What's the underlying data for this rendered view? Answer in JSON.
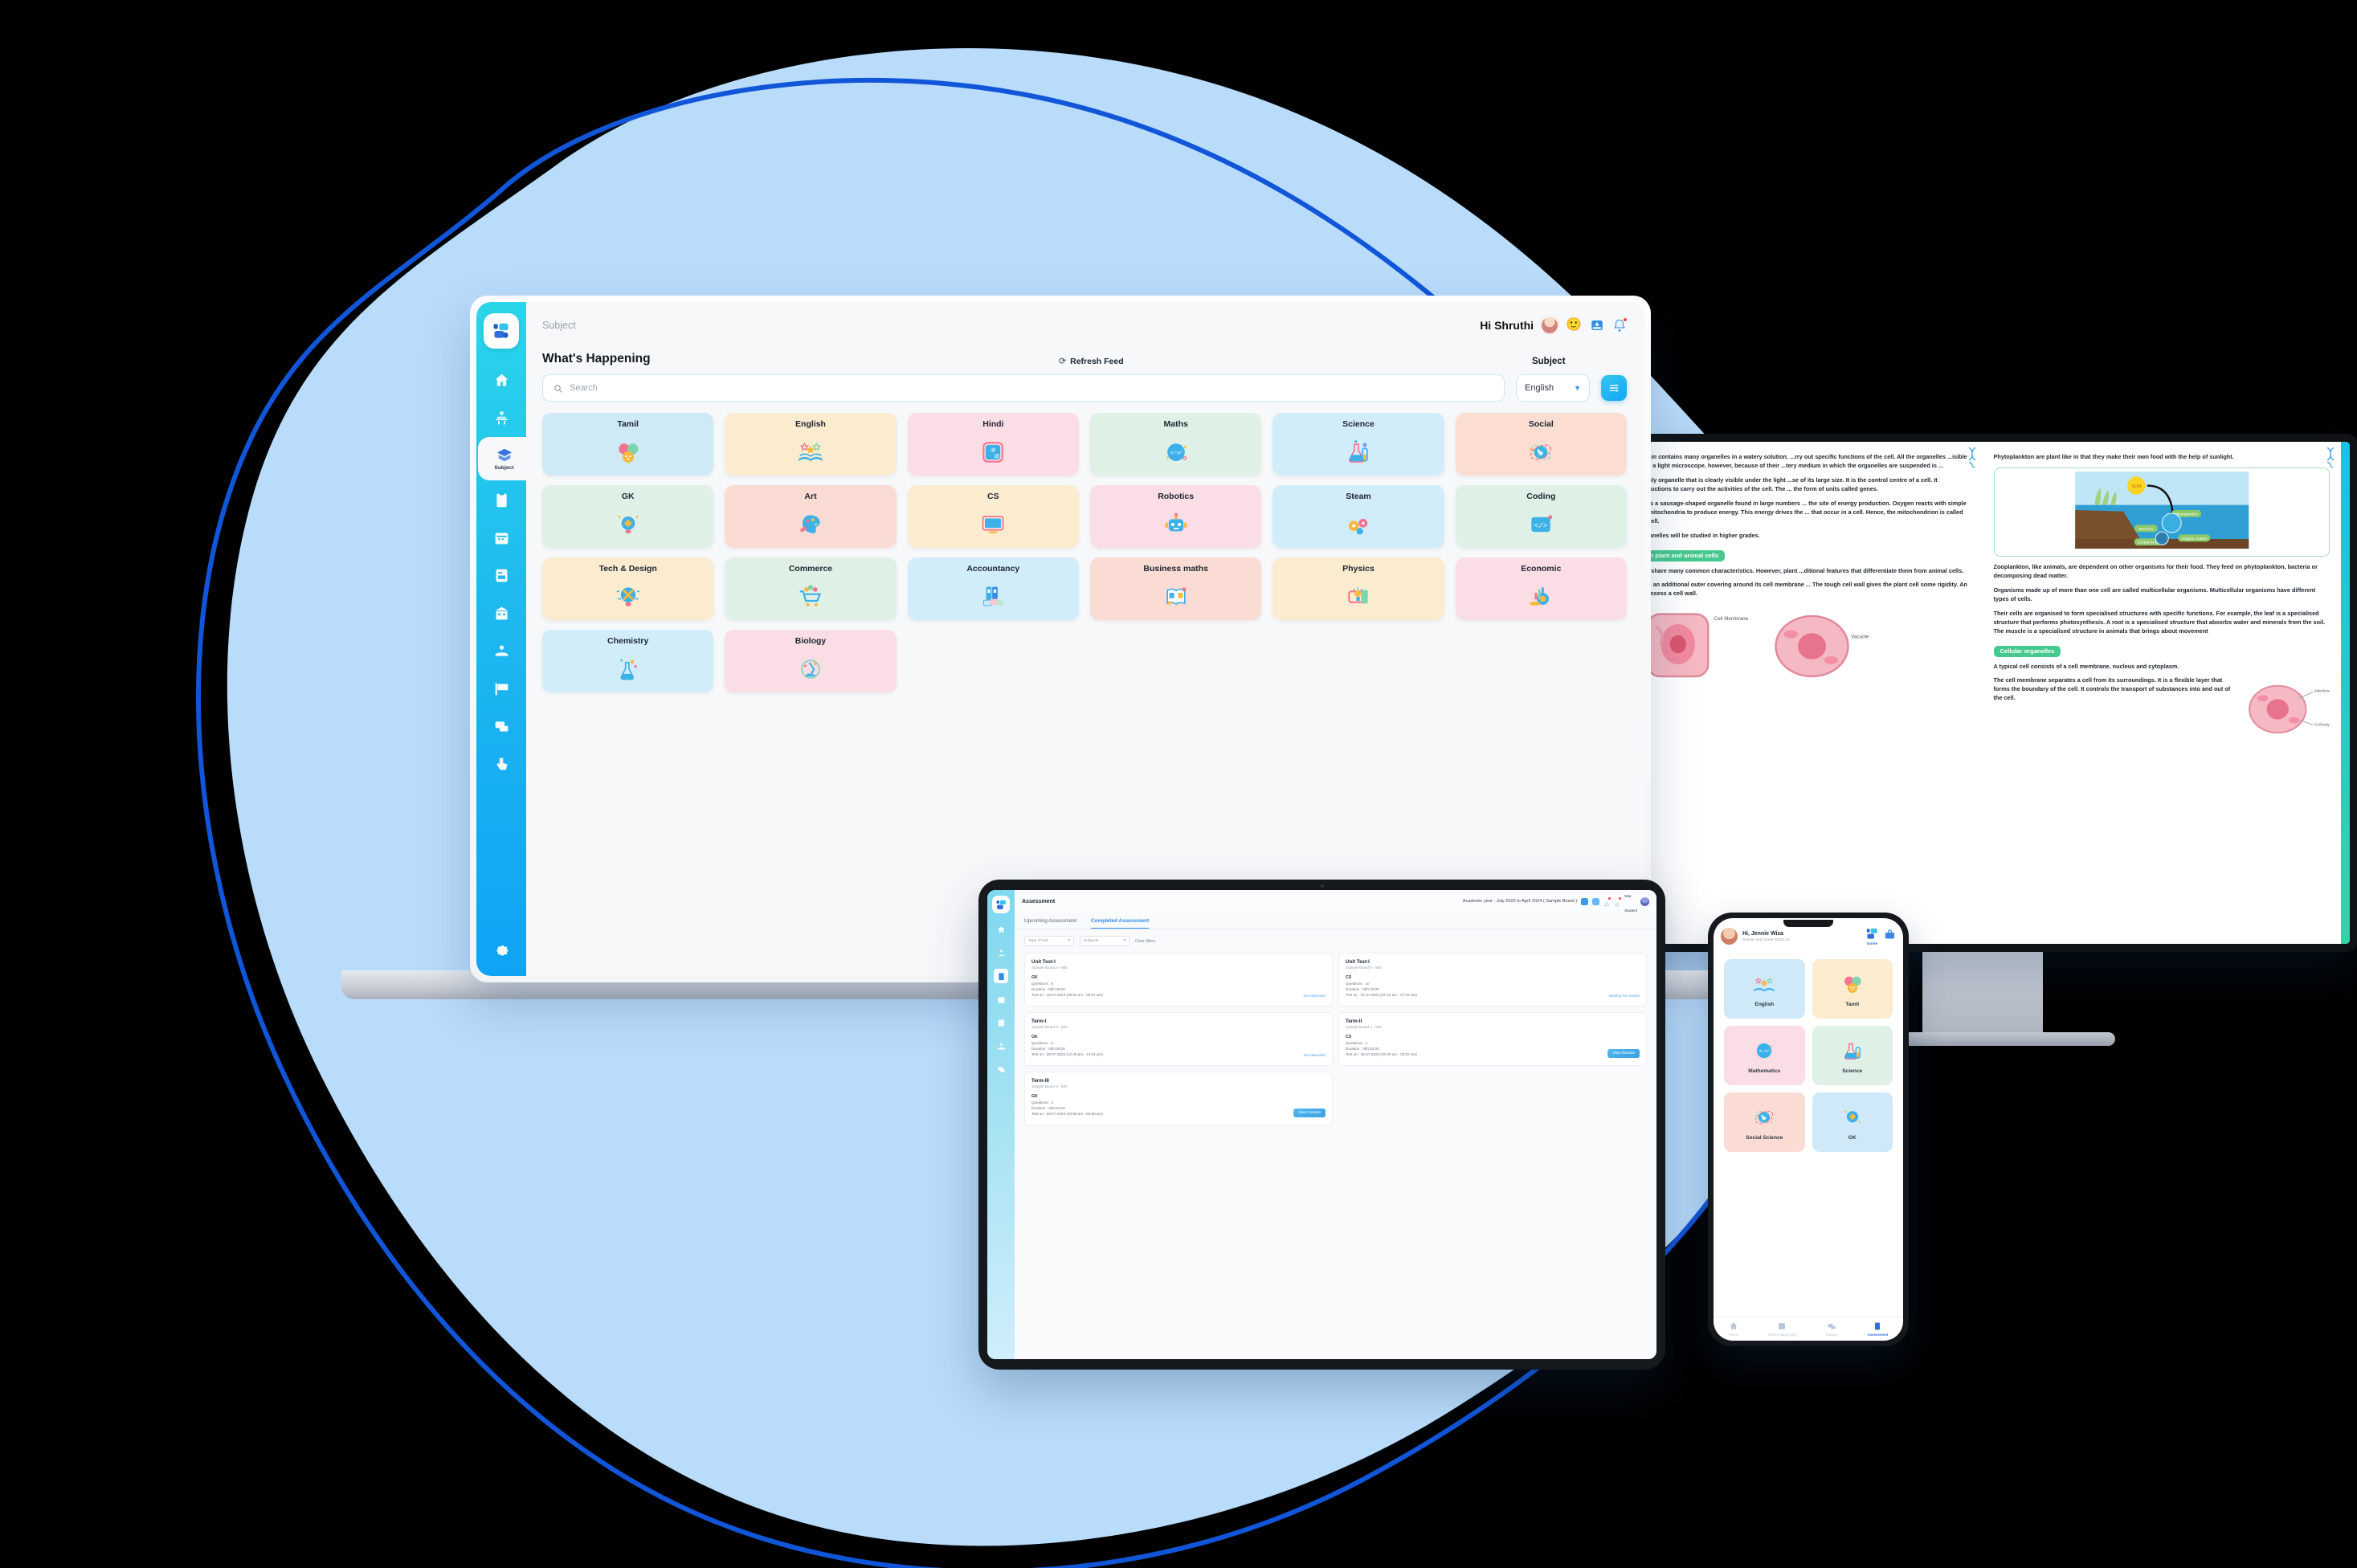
{
  "theme": {
    "blob_fill": "#b9dcfb",
    "blob_stroke": "#1155d8",
    "accent_cyan": "#22c6ec",
    "accent_blue": "#2f8fe8",
    "brand_name": "Izome"
  },
  "laptop": {
    "sidebar": {
      "logo_name": "izome-logo-icon",
      "items": [
        {
          "name": "home",
          "icon": "home-icon",
          "label": "",
          "active": false
        },
        {
          "name": "teacher",
          "icon": "teacher-icon",
          "label": "",
          "active": false
        },
        {
          "name": "subject",
          "icon": "books-stack-icon",
          "label": "Subject",
          "active": true
        },
        {
          "name": "assessment",
          "icon": "clipboard-icon",
          "label": "",
          "active": false
        },
        {
          "name": "timetable",
          "icon": "calendar-icon",
          "label": "",
          "active": false
        },
        {
          "name": "reports",
          "icon": "document-icon",
          "label": "",
          "active": false
        },
        {
          "name": "school",
          "icon": "building-icon",
          "label": "",
          "active": false
        },
        {
          "name": "support",
          "icon": "helping-hand-icon",
          "label": "",
          "active": false
        },
        {
          "name": "noticeboard",
          "icon": "flag-board-icon",
          "label": "",
          "active": false
        },
        {
          "name": "messages",
          "icon": "chat-bubbles-icon",
          "label": "",
          "active": false
        },
        {
          "name": "activity",
          "icon": "click-hand-icon",
          "label": "",
          "active": false
        },
        {
          "name": "settings",
          "icon": "gear-icon",
          "label": "",
          "active": false
        }
      ]
    },
    "topbar": {
      "breadcrumb": "Subject",
      "greeting": "Hi Shruthi",
      "emoji": "🙂",
      "inbox_icon": "inbox-download-icon",
      "bell_icon": "bell-icon",
      "bell_has_badge": true
    },
    "header": {
      "title": "What's Happening",
      "refresh_label": "Refresh Feed",
      "refresh_icon": "refresh-icon",
      "subject_label": "Subject"
    },
    "controls": {
      "search_placeholder": "Search",
      "search_icon": "search-icon",
      "language_selected": "English",
      "filter_icon": "filter-sliders-icon"
    },
    "subjects": [
      {
        "label": "Tamil",
        "bg": "#cfeaf7",
        "icon": "tamil-balloons-icon"
      },
      {
        "label": "English",
        "bg": "#fbecd0",
        "icon": "open-book-stars-icon"
      },
      {
        "label": "Hindi",
        "bg": "#fbdde6",
        "icon": "hindi-letters-icon"
      },
      {
        "label": "Maths",
        "bg": "#dff0e6",
        "icon": "maths-formula-icon"
      },
      {
        "label": "Science",
        "bg": "#d2edfa",
        "icon": "science-flasks-icon"
      },
      {
        "label": "Social",
        "bg": "#fbddd2",
        "icon": "globe-orbit-icon"
      },
      {
        "label": "GK",
        "bg": "#dff0e6",
        "icon": "gk-bulb-icon"
      },
      {
        "label": "Art",
        "bg": "#fbdcd4",
        "icon": "art-palette-icon"
      },
      {
        "label": "CS",
        "bg": "#fbecd0",
        "icon": "computer-icon"
      },
      {
        "label": "Robotics",
        "bg": "#fbdde6",
        "icon": "robot-icon"
      },
      {
        "label": "Steam",
        "bg": "#d2edfa",
        "icon": "steam-gears-icon"
      },
      {
        "label": "Coding",
        "bg": "#dff0e6",
        "icon": "code-brackets-icon"
      },
      {
        "label": "Tech & Design",
        "bg": "#fbecd0",
        "icon": "tech-bulb-icon"
      },
      {
        "label": "Commerce",
        "bg": "#dff0e6",
        "icon": "shopping-cart-icon"
      },
      {
        "label": "Accountancy",
        "bg": "#d2edfa",
        "icon": "ledger-folders-icon"
      },
      {
        "label": "Business maths",
        "bg": "#fbdcd4",
        "icon": "business-book-icon"
      },
      {
        "label": "Physics",
        "bg": "#fbecd0",
        "icon": "physics-circuit-icon"
      },
      {
        "label": "Economic",
        "bg": "#fbdde6",
        "icon": "economy-coins-icon"
      },
      {
        "label": "Chemistry",
        "bg": "#d2edfa",
        "icon": "chemistry-icon"
      },
      {
        "label": "Biology",
        "bg": "#fbdde6",
        "icon": "microscope-icon"
      }
    ]
  },
  "monitor": {
    "left_page": {
      "paragraphs": [
        "...plasm contains many organelles in a watery solution. ...rry out specific functions of the cell. All the organelles ...isible under a light microscope, however, because of their ...tery medium in which the organelles are suspended is ...",
        "...e only organelle that is clearly visible under the light ...se of its large size. It is the control centre of a cell. It ...nstructions to carry out the activities of the cell. The ... the form of units called genes.",
        "...on is a sausage-shaped organelle found in large numbers ... the site of energy production. Oxygen reacts with simple ...he mitochondria to produce energy. This energy drives the ... that occur in a cell. Hence, the mitochondrion is called ...l a cell.",
        "...organelles will be studied in higher grades."
      ],
      "chip": "...en plant and animal cells",
      "after_chip": [
        "...ells share many common characteristics. However, plant ...ditional features that differentiate them from animal cells.",
        "... has an additional outer covering around its cell membrane ... The tough cell wall gives the plant cell some rigidity. An ...t possess a cell wall."
      ],
      "figure_labels": [
        "Cell Membrane",
        "Vacuole"
      ]
    },
    "right_page": {
      "paragraphs": [
        "Phytoplankton are plant like in that they make their own food with the help of sunlight.",
        "Zooplankton, like animals, are dependent on other organisms for their food. They feed on phytoplankton, bacteria or decomposing dead matter.",
        "Organisms made up of more than one cell are called multicellular organisms. Multicellular organisms have different types of cells.",
        "Their cells are organised to form specialised structures with specific functions. For example, the leaf is a specialised structure that performs photosynthesis. A root is a specialised structure that absorbs water and minerals from the soil. The muscle is a specialised structure in animals that brings about movement"
      ],
      "chip": "Cellular organelles",
      "after_chip": [
        "A typical cell consists of a cell membrane, nucleus and cytoplasm.",
        "The cell membrane separates a cell from its surroundings. It is a flexible layer that forms the boundary of the cell. It controls the transport of substances into and out of the cell."
      ],
      "figure_labels": [
        "SUN",
        "Phytoplankton",
        "Bacteria",
        "Zooplankton",
        "Organic matter"
      ],
      "cell_labels": [
        "Mitochondrion",
        "Cell body"
      ]
    }
  },
  "tablet": {
    "title": "Assessment",
    "academic_year": "Academic year - July 2023 to April 2024 ( Sample Board )",
    "user": {
      "name": "Nita",
      "role": "Student"
    },
    "tabs": [
      {
        "label": "Upcoming Assessment",
        "active": false
      },
      {
        "label": "Completed Assessment",
        "active": true
      }
    ],
    "filters": {
      "type_of_test": "Type of test",
      "subjects": "Subjects",
      "clear_label": "Clear filters"
    },
    "cards": [
      {
        "title": "Unit Test-I",
        "board": "Sample Board II - 500",
        "subject": "GK",
        "questions": "Questions : 5",
        "duration": "Duration : 00h:05:00",
        "test_on": "Test on : 28-07-2023 (09:00 am - 09:07 am)",
        "action": "Not attended",
        "action_style": "ghost"
      },
      {
        "title": "Unit Test-I",
        "board": "Sample Board II - 500",
        "subject": "CS",
        "questions": "Questions : 10",
        "duration": "Duration : 00h:10:00",
        "test_on": "Test on : 27-07-2023 (07:12 am - 07:22 am)",
        "action": "Waiting for results",
        "action_style": "ghost"
      },
      {
        "title": "Term-I",
        "board": "Sample Board II - 500",
        "subject": "GK",
        "questions": "Questions : 5",
        "duration": "Duration : 00h:05:00",
        "test_on": "Test on : 28-07-2023 (12:49 pm - 12:54 pm)",
        "action": "Not attended",
        "action_style": "ghost"
      },
      {
        "title": "Term-II",
        "board": "Sample Board II - 500",
        "subject": "CS",
        "questions": "Questions : 2",
        "duration": "Duration : 00h:02:00",
        "test_on": "Test on : 26-07-2023 (03:20 am - 03:22 am)",
        "action": "View Results",
        "action_style": "solid"
      },
      {
        "title": "Term-III",
        "board": "Sample Board II - 500",
        "subject": "GK",
        "questions": "Questions : 4",
        "duration": "Duration : 00h:04:00",
        "test_on": "Test on : 26-07-2023 (03:56 am - 04:00 am)",
        "action": "View Results",
        "action_style": "solid"
      }
    ]
  },
  "phone": {
    "greeting": "Hi, Jennie Wiza",
    "sub": "Results and Grade #2023-24",
    "brand": "Izome",
    "subjects": [
      {
        "label": "English",
        "bg": "#cfe9f8",
        "icon": "open-book-stars-icon"
      },
      {
        "label": "Tamil",
        "bg": "#fbecd0",
        "icon": "tamil-balloons-icon"
      },
      {
        "label": "Mathematics",
        "bg": "#fbdde6",
        "icon": "maths-formula-icon"
      },
      {
        "label": "Science",
        "bg": "#dff0e6",
        "icon": "science-flasks-icon"
      },
      {
        "label": "Social Science",
        "bg": "#fbdcd4",
        "icon": "globe-orbit-icon"
      },
      {
        "label": "GK",
        "bg": "#cfe9f8",
        "icon": "gk-bulb-icon"
      }
    ],
    "nav": [
      {
        "label": "Home",
        "icon": "home-icon",
        "active": false
      },
      {
        "label": "What's happening",
        "icon": "feed-icon",
        "active": false
      },
      {
        "label": "Subject",
        "icon": "subject-icon",
        "active": false
      },
      {
        "label": "Assessment",
        "icon": "assessment-icon",
        "active": true
      }
    ]
  }
}
